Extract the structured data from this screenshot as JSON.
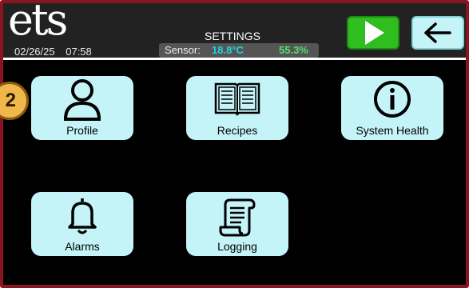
{
  "header": {
    "logo_text": "ets",
    "date": "02/26/25",
    "time": "07:58",
    "title": "SETTINGS",
    "sensor_label": "Sensor:",
    "sensor_temp": "18.8°C",
    "sensor_humidity": "55.3%"
  },
  "tiles": [
    {
      "label": "Profile",
      "icon": "person-icon"
    },
    {
      "label": "Recipes",
      "icon": "book-icon"
    },
    {
      "label": "System Health",
      "icon": "info-icon"
    },
    {
      "label": "Alarms",
      "icon": "bell-icon"
    },
    {
      "label": "Logging",
      "icon": "scroll-icon"
    }
  ],
  "badge": {
    "text": "2"
  },
  "colors": {
    "frame": "#8a1420",
    "tile": "#c4f4f8",
    "play": "#2fbd20",
    "sensor_temp": "#1fd6e0",
    "sensor_humidity": "#55e070"
  }
}
